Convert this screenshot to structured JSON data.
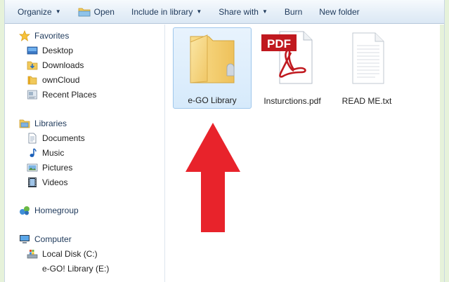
{
  "toolbar": {
    "organize": "Organize",
    "open": "Open",
    "include_in_library": "Include in library",
    "share_with": "Share with",
    "burn": "Burn",
    "new_folder": "New folder"
  },
  "nav": {
    "favorites": "Favorites",
    "desktop": "Desktop",
    "downloads": "Downloads",
    "owncloud": "ownCloud",
    "recent_places": "Recent Places",
    "libraries": "Libraries",
    "documents": "Documents",
    "music": "Music",
    "pictures": "Pictures",
    "videos": "Videos",
    "homegroup": "Homegroup",
    "computer": "Computer",
    "local_disk": "Local Disk (C:)",
    "ego_library_drive": "e-GO! Library (E:)"
  },
  "files": [
    {
      "name": "e-GO Library",
      "type": "folder",
      "selected": true
    },
    {
      "name": "Insturctions.pdf",
      "type": "pdf",
      "selected": false
    },
    {
      "name": "READ ME.txt",
      "type": "txt",
      "selected": false
    }
  ],
  "pdf_badge": "PDF",
  "colors": {
    "accent_arrow": "#e8232b",
    "selection": "#d6eafb",
    "outer_background": "#e6f2da"
  }
}
